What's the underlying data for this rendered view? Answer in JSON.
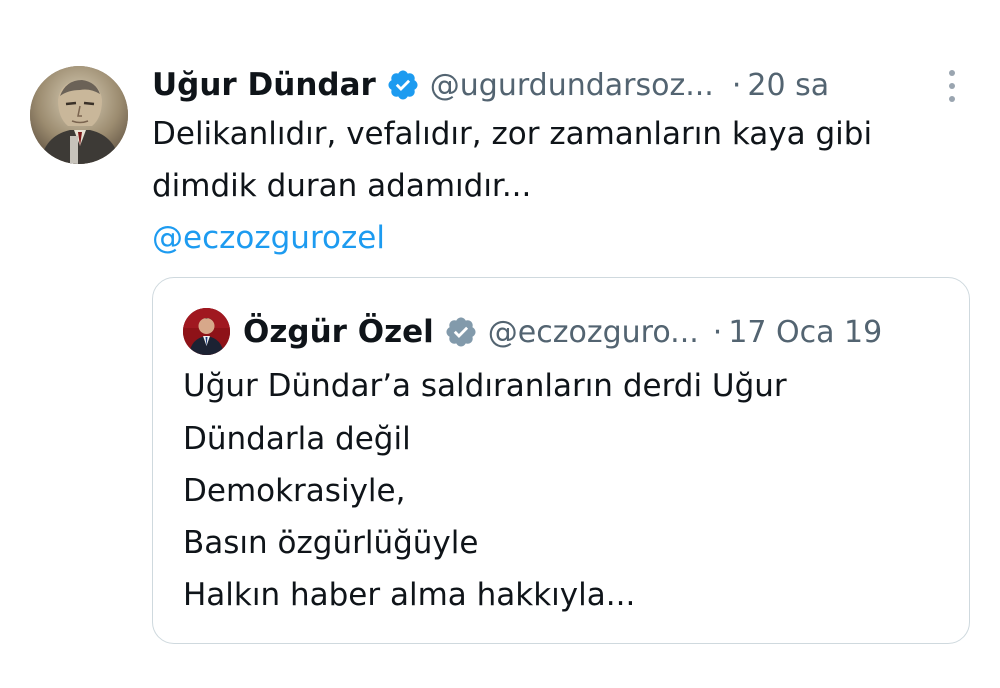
{
  "tweet": {
    "author_name": "Uğur Dündar",
    "author_handle": "@ugurdundarsoz...",
    "separator": "·",
    "time": "20 sa",
    "text_lines": [
      "Delikanlıdır, vefalıdır, zor zamanların kaya gibi",
      "dimdik duran adamıdır..."
    ],
    "mention": "@eczozgurozel"
  },
  "quoted_tweet": {
    "author_name": "Özgür Özel",
    "author_handle": "@eczozguro...",
    "separator": "·",
    "time": "17 Oca 19",
    "text_lines": [
      "Uğur Dündar’a saldıranların derdi Uğur",
      "Dündarla değil",
      "Demokrasiyle,",
      "Basın özgürlüğüyle",
      "Halkın haber alma hakkıyla..."
    ]
  },
  "colors": {
    "text": "#0f1419",
    "secondary": "#536471",
    "link": "#1d9bf0",
    "border": "#cfd9de",
    "verified_blue": "#1d9bf0",
    "verified_gray": "#829aab"
  },
  "icons": {
    "verified": "verified-badge-icon",
    "verified_gray": "gray-verified-badge-icon",
    "more": "more-vertical-icon"
  }
}
